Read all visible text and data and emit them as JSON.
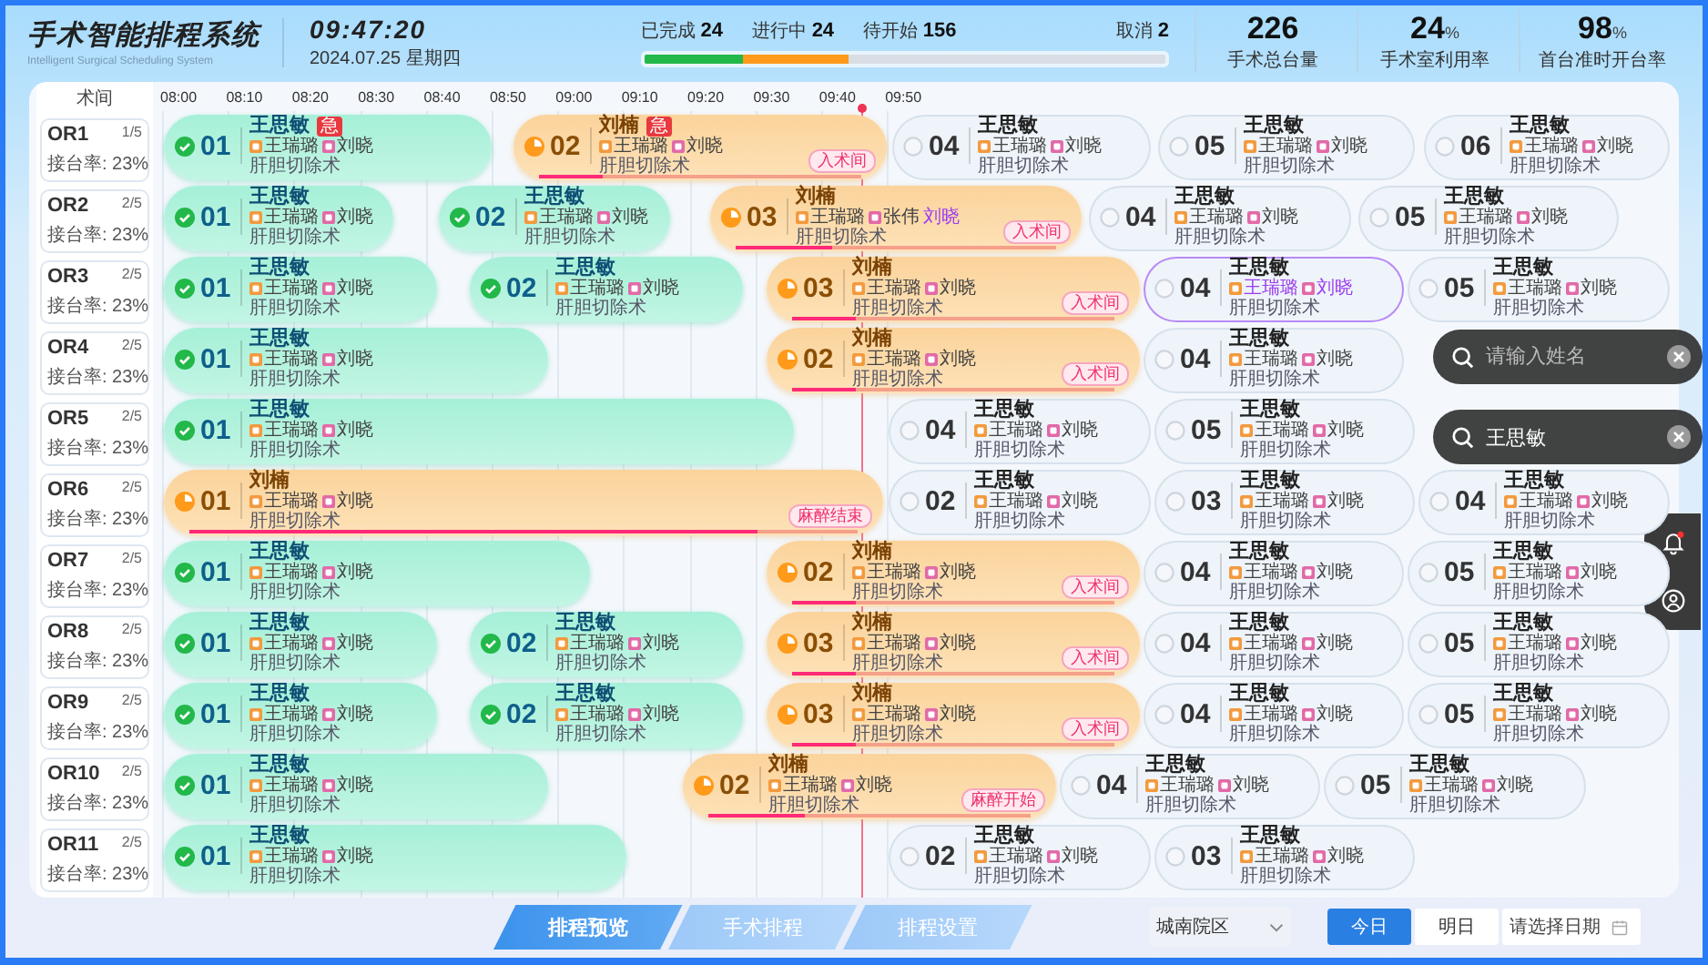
{
  "header": {
    "title": "手术智能排程系统",
    "subtitle": "Intelligent Surgical Scheduling System",
    "time": "09:47:20",
    "date": "2024.07.25  星期四"
  },
  "counts": [
    {
      "label": "已完成",
      "value": "24"
    },
    {
      "label": "进行中",
      "value": "24"
    },
    {
      "label": "待开始",
      "value": "156"
    }
  ],
  "cancelled": {
    "label": "取消",
    "value": "2"
  },
  "progress": [
    {
      "kind": "done",
      "level": 0.19
    },
    {
      "kind": "active",
      "level": 0.2
    }
  ],
  "kpis": [
    {
      "value": "226",
      "label": "手术总台量"
    },
    {
      "value": "24",
      "unit": "%",
      "label": "手术室利用率"
    },
    {
      "value": "98",
      "unit": "%",
      "label": "首台准时开台率"
    }
  ],
  "room_header": "术间",
  "times": [
    "08:00",
    "08:10",
    "08:20",
    "08:30",
    "08:40",
    "08:50",
    "09:00",
    "09:10",
    "09:20",
    "09:30",
    "09:40",
    "09:50"
  ],
  "rooms": [
    {
      "name": "OR1",
      "count": "1/5",
      "rate": "接台率: 23%",
      "blocks": [
        {
          "no": "01",
          "kind": "done",
          "name": "王思敏",
          "badge": "急",
          "staff": [
            {
              "name": "王瑞璐",
              "kind": "anesthesia"
            },
            {
              "name": "刘晓",
              "kind": "nurse"
            }
          ],
          "procedure": "肝胆切除术",
          "highlighted": false
        },
        {
          "no": "02",
          "kind": "active",
          "name": "刘楠",
          "badge": "急",
          "staff": [
            {
              "name": "王瑞璐",
              "kind": "anesthesia"
            },
            {
              "name": "刘晓",
              "kind": "nurse"
            }
          ],
          "procedure": "肝胆切除术",
          "tag": "入术间",
          "level": 0.2,
          "highlighted": false
        },
        {
          "no": "04",
          "kind": "waiting",
          "name": "王思敏",
          "staff": [
            {
              "name": "王瑞璐",
              "kind": "anesthesia"
            },
            {
              "name": "刘晓",
              "kind": "nurse"
            }
          ],
          "procedure": "肝胆切除术",
          "highlighted": false
        },
        {
          "no": "05",
          "kind": "waiting",
          "name": "王思敏",
          "staff": [
            {
              "name": "王瑞璐",
              "kind": "anesthesia"
            },
            {
              "name": "刘晓",
              "kind": "nurse"
            }
          ],
          "procedure": "肝胆切除术",
          "highlighted": false
        },
        {
          "no": "06",
          "kind": "waiting",
          "name": "王思敏",
          "staff": [
            {
              "name": "王瑞璐",
              "kind": "anesthesia"
            },
            {
              "name": "刘晓",
              "kind": "nurse"
            }
          ],
          "procedure": "肝胆切除术",
          "highlighted": false
        }
      ]
    },
    {
      "name": "OR2",
      "count": "2/5",
      "rate": "接台率: 23%",
      "blocks": [
        {
          "no": "01",
          "kind": "done",
          "name": "王思敏",
          "staff": [
            {
              "name": "王瑞璐",
              "kind": "anesthesia"
            },
            {
              "name": "刘晓",
              "kind": "nurse"
            }
          ],
          "procedure": "肝胆切除术",
          "highlighted": false
        },
        {
          "no": "02",
          "kind": "done",
          "name": "王思敏",
          "staff": [
            {
              "name": "王瑞璐",
              "kind": "anesthesia"
            },
            {
              "name": "刘晓",
              "kind": "nurse"
            }
          ],
          "procedure": "肝胆切除术",
          "highlighted": false
        },
        {
          "no": "03",
          "kind": "active",
          "name": "刘楠",
          "staff": [
            {
              "name": "王瑞璐",
              "kind": "anesthesia"
            },
            {
              "name": "张伟",
              "kind": "nurse"
            },
            {
              "name": "刘晓",
              "kind": "other"
            }
          ],
          "procedure": "肝胆切除术",
          "tag": "入术间",
          "level": 0.3,
          "highlighted": false
        },
        {
          "no": "04",
          "kind": "waiting",
          "name": "王思敏",
          "staff": [
            {
              "name": "王瑞璐",
              "kind": "anesthesia"
            },
            {
              "name": "刘晓",
              "kind": "nurse"
            }
          ],
          "procedure": "肝胆切除术",
          "highlighted": false
        },
        {
          "no": "05",
          "kind": "waiting",
          "name": "王思敏",
          "staff": [
            {
              "name": "王瑞璐",
              "kind": "anesthesia"
            },
            {
              "name": "刘晓",
              "kind": "nurse"
            }
          ],
          "procedure": "肝胆切除术",
          "highlighted": false
        }
      ]
    },
    {
      "name": "OR3",
      "count": "2/5",
      "rate": "接台率: 23%",
      "blocks": [
        {
          "no": "01",
          "kind": "done",
          "name": "王思敏",
          "staff": [
            {
              "name": "王瑞璐",
              "kind": "anesthesia"
            },
            {
              "name": "刘晓",
              "kind": "nurse"
            }
          ],
          "procedure": "肝胆切除术",
          "highlighted": false
        },
        {
          "no": "02",
          "kind": "done",
          "name": "王思敏",
          "staff": [
            {
              "name": "王瑞璐",
              "kind": "anesthesia"
            },
            {
              "name": "刘晓",
              "kind": "nurse"
            }
          ],
          "procedure": "肝胆切除术",
          "highlighted": false
        },
        {
          "no": "03",
          "kind": "active",
          "name": "刘楠",
          "staff": [
            {
              "name": "王瑞璐",
              "kind": "anesthesia"
            },
            {
              "name": "刘晓",
              "kind": "nurse"
            }
          ],
          "procedure": "肝胆切除术",
          "tag": "入术间",
          "level": 0.2,
          "highlighted": false
        },
        {
          "no": "04",
          "kind": "waiting",
          "name": "王思敏",
          "staff": [
            {
              "name": "王瑞璐",
              "kind": "anesthesia"
            },
            {
              "name": "刘晓",
              "kind": "nurse"
            }
          ],
          "procedure": "肝胆切除术",
          "highlighted": true
        },
        {
          "no": "05",
          "kind": "waiting",
          "name": "王思敏",
          "staff": [
            {
              "name": "王瑞璐",
              "kind": "anesthesia"
            },
            {
              "name": "刘晓",
              "kind": "nurse"
            }
          ],
          "procedure": "肝胆切除术",
          "highlighted": false
        }
      ]
    },
    {
      "name": "OR4",
      "count": "2/5",
      "rate": "接台率: 23%",
      "blocks": [
        {
          "no": "01",
          "kind": "done",
          "name": "王思敏",
          "staff": [
            {
              "name": "王瑞璐",
              "kind": "anesthesia"
            },
            {
              "name": "刘晓",
              "kind": "nurse"
            }
          ],
          "procedure": "肝胆切除术",
          "highlighted": false
        },
        {
          "no": "02",
          "kind": "active",
          "name": "刘楠",
          "staff": [
            {
              "name": "王瑞璐",
              "kind": "anesthesia"
            },
            {
              "name": "刘晓",
              "kind": "nurse"
            }
          ],
          "procedure": "肝胆切除术",
          "tag": "入术间",
          "level": 0.2,
          "highlighted": false
        },
        {
          "no": "04",
          "kind": "waiting",
          "name": "王思敏",
          "staff": [
            {
              "name": "王瑞璐",
              "kind": "anesthesia"
            },
            {
              "name": "刘晓",
              "kind": "nurse"
            }
          ],
          "procedure": "肝胆切除术",
          "highlighted": false
        }
      ]
    },
    {
      "name": "OR5",
      "count": "2/5",
      "rate": "接台率: 23%",
      "blocks": [
        {
          "no": "01",
          "kind": "done",
          "name": "王思敏",
          "staff": [
            {
              "name": "王瑞璐",
              "kind": "anesthesia"
            },
            {
              "name": "刘晓",
              "kind": "nurse"
            }
          ],
          "procedure": "肝胆切除术",
          "highlighted": false
        },
        {
          "no": "04",
          "kind": "waiting",
          "name": "王思敏",
          "staff": [
            {
              "name": "王瑞璐",
              "kind": "anesthesia"
            },
            {
              "name": "刘晓",
              "kind": "nurse"
            }
          ],
          "procedure": "肝胆切除术",
          "highlighted": false
        },
        {
          "no": "05",
          "kind": "waiting",
          "name": "王思敏",
          "staff": [
            {
              "name": "王瑞璐",
              "kind": "anesthesia"
            },
            {
              "name": "刘晓",
              "kind": "nurse"
            }
          ],
          "procedure": "肝胆切除术",
          "highlighted": false
        }
      ]
    },
    {
      "name": "OR6",
      "count": "2/5",
      "rate": "接台率: 23%",
      "blocks": [
        {
          "no": "01",
          "kind": "active",
          "name": "刘楠",
          "staff": [
            {
              "name": "王瑞璐",
              "kind": "anesthesia"
            },
            {
              "name": "刘晓",
              "kind": "nurse"
            }
          ],
          "procedure": "肝胆切除术",
          "tag": "麻醉结束",
          "level": 0.85,
          "highlighted": false
        },
        {
          "no": "02",
          "kind": "waiting",
          "name": "王思敏",
          "staff": [
            {
              "name": "王瑞璐",
              "kind": "anesthesia"
            },
            {
              "name": "刘晓",
              "kind": "nurse"
            }
          ],
          "procedure": "肝胆切除术",
          "highlighted": false
        },
        {
          "no": "03",
          "kind": "waiting",
          "name": "王思敏",
          "staff": [
            {
              "name": "王瑞璐",
              "kind": "anesthesia"
            },
            {
              "name": "刘晓",
              "kind": "nurse"
            }
          ],
          "procedure": "肝胆切除术",
          "highlighted": false
        },
        {
          "no": "04",
          "kind": "waiting",
          "name": "王思敏",
          "staff": [
            {
              "name": "王瑞璐",
              "kind": "anesthesia"
            },
            {
              "name": "刘晓",
              "kind": "nurse"
            }
          ],
          "procedure": "肝胆切除术",
          "highlighted": false
        }
      ]
    },
    {
      "name": "OR7",
      "count": "2/5",
      "rate": "接台率: 23%",
      "blocks": [
        {
          "no": "01",
          "kind": "done",
          "name": "王思敏",
          "staff": [
            {
              "name": "王瑞璐",
              "kind": "anesthesia"
            },
            {
              "name": "刘晓",
              "kind": "nurse"
            }
          ],
          "procedure": "肝胆切除术",
          "highlighted": false
        },
        {
          "no": "02",
          "kind": "active",
          "name": "刘楠",
          "staff": [
            {
              "name": "王瑞璐",
              "kind": "anesthesia"
            },
            {
              "name": "刘晓",
              "kind": "nurse"
            }
          ],
          "procedure": "肝胆切除术",
          "tag": "入术间",
          "level": 0.2,
          "highlighted": false
        },
        {
          "no": "04",
          "kind": "waiting",
          "name": "王思敏",
          "staff": [
            {
              "name": "王瑞璐",
              "kind": "anesthesia"
            },
            {
              "name": "刘晓",
              "kind": "nurse"
            }
          ],
          "procedure": "肝胆切除术",
          "highlighted": false
        },
        {
          "no": "05",
          "kind": "waiting",
          "name": "王思敏",
          "staff": [
            {
              "name": "王瑞璐",
              "kind": "anesthesia"
            },
            {
              "name": "刘晓",
              "kind": "nurse"
            }
          ],
          "procedure": "肝胆切除术",
          "highlighted": false
        }
      ]
    },
    {
      "name": "OR8",
      "count": "2/5",
      "rate": "接台率: 23%",
      "blocks": [
        {
          "no": "01",
          "kind": "done",
          "name": "王思敏",
          "staff": [
            {
              "name": "王瑞璐",
              "kind": "anesthesia"
            },
            {
              "name": "刘晓",
              "kind": "nurse"
            }
          ],
          "procedure": "肝胆切除术",
          "highlighted": false
        },
        {
          "no": "02",
          "kind": "done",
          "name": "王思敏",
          "staff": [
            {
              "name": "王瑞璐",
              "kind": "anesthesia"
            },
            {
              "name": "刘晓",
              "kind": "nurse"
            }
          ],
          "procedure": "肝胆切除术",
          "highlighted": false
        },
        {
          "no": "03",
          "kind": "active",
          "name": "刘楠",
          "staff": [
            {
              "name": "王瑞璐",
              "kind": "anesthesia"
            },
            {
              "name": "刘晓",
              "kind": "nurse"
            }
          ],
          "procedure": "肝胆切除术",
          "tag": "入术间",
          "level": 0.2,
          "highlighted": false
        },
        {
          "no": "04",
          "kind": "waiting",
          "name": "王思敏",
          "staff": [
            {
              "name": "王瑞璐",
              "kind": "anesthesia"
            },
            {
              "name": "刘晓",
              "kind": "nurse"
            }
          ],
          "procedure": "肝胆切除术",
          "highlighted": false
        },
        {
          "no": "05",
          "kind": "waiting",
          "name": "王思敏",
          "staff": [
            {
              "name": "王瑞璐",
              "kind": "anesthesia"
            },
            {
              "name": "刘晓",
              "kind": "nurse"
            }
          ],
          "procedure": "肝胆切除术",
          "highlighted": false
        }
      ]
    },
    {
      "name": "OR9",
      "count": "2/5",
      "rate": "接台率: 23%",
      "blocks": [
        {
          "no": "01",
          "kind": "done",
          "name": "王思敏",
          "staff": [
            {
              "name": "王瑞璐",
              "kind": "anesthesia"
            },
            {
              "name": "刘晓",
              "kind": "nurse"
            }
          ],
          "procedure": "肝胆切除术",
          "highlighted": false
        },
        {
          "no": "02",
          "kind": "done",
          "name": "王思敏",
          "staff": [
            {
              "name": "王瑞璐",
              "kind": "anesthesia"
            },
            {
              "name": "刘晓",
              "kind": "nurse"
            }
          ],
          "procedure": "肝胆切除术",
          "highlighted": false
        },
        {
          "no": "03",
          "kind": "active",
          "name": "刘楠",
          "staff": [
            {
              "name": "王瑞璐",
              "kind": "anesthesia"
            },
            {
              "name": "刘晓",
              "kind": "nurse"
            }
          ],
          "procedure": "肝胆切除术",
          "tag": "入术间",
          "level": 0.2,
          "highlighted": false
        },
        {
          "no": "04",
          "kind": "waiting",
          "name": "王思敏",
          "staff": [
            {
              "name": "王瑞璐",
              "kind": "anesthesia"
            },
            {
              "name": "刘晓",
              "kind": "nurse"
            }
          ],
          "procedure": "肝胆切除术",
          "highlighted": false
        },
        {
          "no": "05",
          "kind": "waiting",
          "name": "王思敏",
          "staff": [
            {
              "name": "王瑞璐",
              "kind": "anesthesia"
            },
            {
              "name": "刘晓",
              "kind": "nurse"
            }
          ],
          "procedure": "肝胆切除术",
          "highlighted": false
        }
      ]
    },
    {
      "name": "OR10",
      "count": "2/5",
      "rate": "接台率: 23%",
      "blocks": [
        {
          "no": "01",
          "kind": "done",
          "name": "王思敏",
          "staff": [
            {
              "name": "王瑞璐",
              "kind": "anesthesia"
            },
            {
              "name": "刘晓",
              "kind": "nurse"
            }
          ],
          "procedure": "肝胆切除术",
          "highlighted": false
        },
        {
          "no": "02",
          "kind": "active",
          "name": "刘楠",
          "staff": [
            {
              "name": "王瑞璐",
              "kind": "anesthesia"
            },
            {
              "name": "刘晓",
              "kind": "nurse"
            }
          ],
          "procedure": "肝胆切除术",
          "tag": "麻醉开始",
          "level": 0.3,
          "highlighted": false
        },
        {
          "no": "04",
          "kind": "waiting",
          "name": "王思敏",
          "staff": [
            {
              "name": "王瑞璐",
              "kind": "anesthesia"
            },
            {
              "name": "刘晓",
              "kind": "nurse"
            }
          ],
          "procedure": "肝胆切除术",
          "highlighted": false
        },
        {
          "no": "05",
          "kind": "waiting",
          "name": "王思敏",
          "staff": [
            {
              "name": "王瑞璐",
              "kind": "anesthesia"
            },
            {
              "name": "刘晓",
              "kind": "nurse"
            }
          ],
          "procedure": "肝胆切除术",
          "highlighted": false
        }
      ]
    },
    {
      "name": "OR11",
      "count": "2/5",
      "rate": "接台率: 23%",
      "blocks": [
        {
          "no": "01",
          "kind": "done",
          "name": "王思敏",
          "staff": [
            {
              "name": "王瑞璐",
              "kind": "anesthesia"
            },
            {
              "name": "刘晓",
              "kind": "nurse"
            }
          ],
          "procedure": "肝胆切除术",
          "highlighted": false
        },
        {
          "no": "02",
          "kind": "waiting",
          "name": "王思敏",
          "staff": [
            {
              "name": "王瑞璐",
              "kind": "anesthesia"
            },
            {
              "name": "刘晓",
              "kind": "nurse"
            }
          ],
          "procedure": "肝胆切除术",
          "highlighted": false
        },
        {
          "no": "03",
          "kind": "waiting",
          "name": "王思敏",
          "staff": [
            {
              "name": "王瑞璐",
              "kind": "anesthesia"
            },
            {
              "name": "刘晓",
              "kind": "nurse"
            }
          ],
          "procedure": "肝胆切除术",
          "highlighted": false
        }
      ]
    }
  ],
  "searches": [
    {
      "placeholder": "请输入姓名"
    },
    {
      "value": "王思敏"
    }
  ],
  "notifications": {
    "unread": true
  },
  "nav_tabs": [
    {
      "label": "排程预览",
      "selected": true
    },
    {
      "label": "手术排程",
      "selected": false
    },
    {
      "label": "排程设置",
      "selected": false
    }
  ],
  "campus": {
    "value": "城南院区"
  },
  "day_buttons": [
    {
      "label": "今日",
      "selected": true
    },
    {
      "label": "明日",
      "selected": false
    }
  ],
  "date_field": {
    "placeholder": "请选择日期"
  }
}
